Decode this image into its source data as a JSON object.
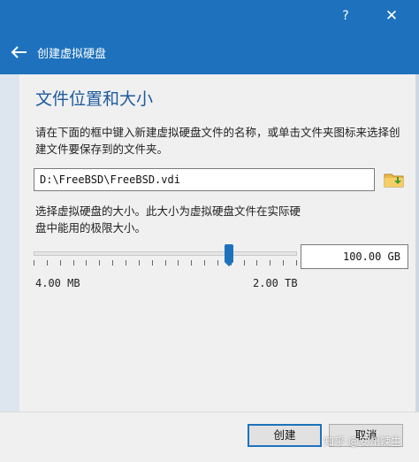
{
  "window": {
    "help_label": "?",
    "close_label": "✕",
    "titlebar_color": "#1e72bd"
  },
  "header": {
    "back_icon": "back-arrow-icon",
    "title": "创建虚拟硬盘"
  },
  "location": {
    "section_title": "文件位置和大小",
    "description": "请在下面的框中键入新建虚拟硬盘文件的名称，或单击文件夹图标来选择创建文件要保存到的文件夹。",
    "path_value": "D:\\FreeBSD\\FreeBSD.vdi",
    "folder_icon": "folder-icon"
  },
  "size": {
    "description": "选择虚拟硬盘的大小。此大小为虚拟硬盘文件在实际硬盘中能用的极限大小。",
    "slider_position": 0.75,
    "value": "100.00 GB",
    "min_label": "4.00 MB",
    "max_label": "2.00 TB"
  },
  "footer": {
    "create_label": "创建",
    "cancel_label": "取消"
  },
  "watermark": "知乎 @安州辣生"
}
